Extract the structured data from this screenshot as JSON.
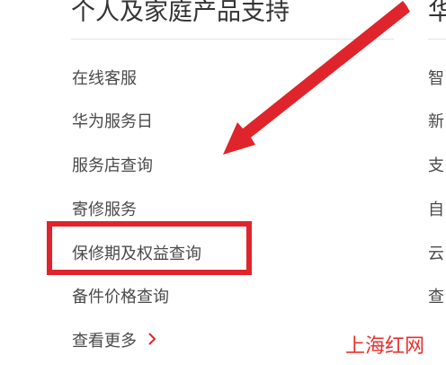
{
  "support": {
    "title": "个人及家庭产品支持",
    "links": [
      "在线客服",
      "华为服务日",
      "服务店查询",
      "寄修服务",
      "保修期及权益查询",
      "备件价格查询"
    ],
    "more_label": "查看更多"
  },
  "right_column": {
    "title": "华",
    "items": [
      "智",
      "新",
      "支",
      "自",
      "云",
      "查"
    ]
  },
  "annotation": {
    "highlight_color": "#e0242b",
    "arrow_color": "#e0242b"
  },
  "watermark": {
    "text": "上海红网"
  }
}
